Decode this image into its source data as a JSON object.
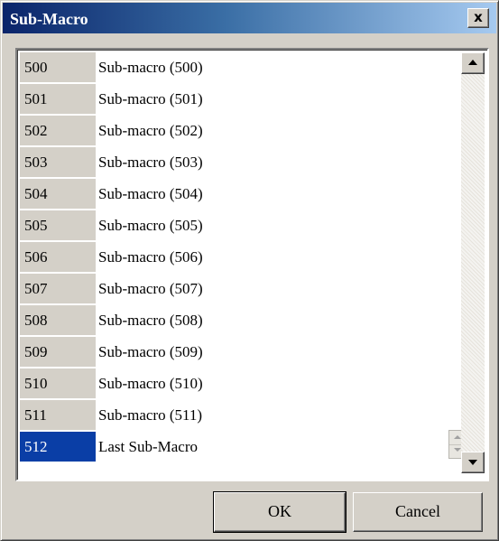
{
  "window": {
    "title": "Sub-Macro",
    "close_glyph": "x"
  },
  "list": {
    "rows": [
      {
        "id": "500",
        "name": "Sub-macro (500)"
      },
      {
        "id": "501",
        "name": "Sub-macro (501)"
      },
      {
        "id": "502",
        "name": "Sub-macro (502)"
      },
      {
        "id": "503",
        "name": "Sub-macro (503)"
      },
      {
        "id": "504",
        "name": "Sub-macro (504)"
      },
      {
        "id": "505",
        "name": "Sub-macro (505)"
      },
      {
        "id": "506",
        "name": "Sub-macro (506)"
      },
      {
        "id": "507",
        "name": "Sub-macro (507)"
      },
      {
        "id": "508",
        "name": "Sub-macro (508)"
      },
      {
        "id": "509",
        "name": "Sub-macro (509)"
      },
      {
        "id": "510",
        "name": "Sub-macro (510)"
      },
      {
        "id": "511",
        "name": "Sub-macro (511)"
      },
      {
        "id": "512",
        "name": "Last Sub-Macro"
      }
    ],
    "selected_id": "512"
  },
  "buttons": {
    "ok_label": "OK",
    "cancel_label": "Cancel"
  },
  "icons": {
    "close": "close-icon",
    "scroll_up": "scroll-up-arrow-icon",
    "scroll_down": "scroll-down-arrow-icon",
    "spin_up": "spin-up-icon",
    "spin_down": "spin-down-icon"
  },
  "colors": {
    "selection": "#0a3ea6",
    "title_bar_start": "#0a246a",
    "title_bar_end": "#a6caf0",
    "dialog_face": "#d4d0c8"
  }
}
